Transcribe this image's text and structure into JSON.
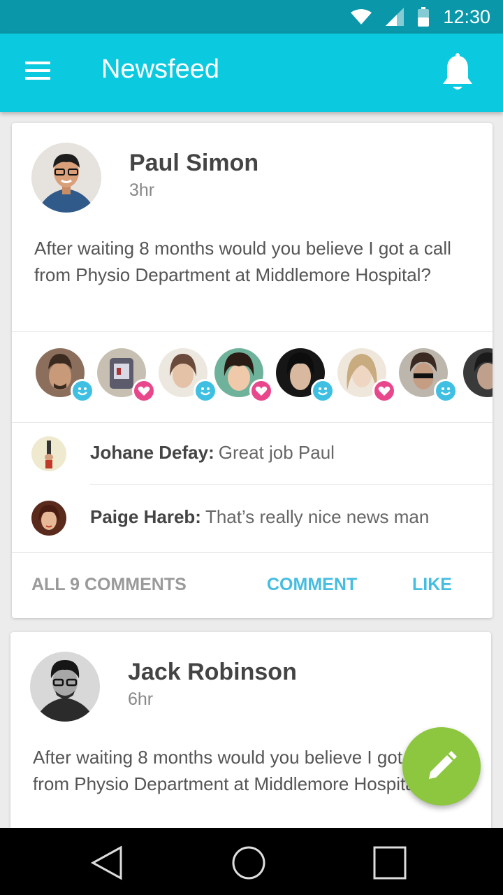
{
  "status_bar": {
    "time": "12:30"
  },
  "app_bar": {
    "title": "Newsfeed",
    "menu_icon": "menu-icon",
    "notification_icon": "bell-icon"
  },
  "colors": {
    "status_bar": "#0a97a9",
    "app_bar": "#0bcadf",
    "accent": "#45bde0",
    "fab": "#8dc63f",
    "heart": "#e8478c",
    "smile": "#3fc0e3"
  },
  "posts": [
    {
      "author": "Paul Simon",
      "time": "3hr",
      "text": "After waiting 8 months would you believe I got a call from Physio Department at Middlemore Hospital?",
      "reactions": [
        "smile",
        "heart",
        "smile",
        "heart",
        "smile",
        "heart",
        "smile",
        "none"
      ],
      "comments": [
        {
          "name": "Johane Defay:",
          "text": "Great job Paul"
        },
        {
          "name": "Paige Hareb:",
          "text": "That’s really nice news man"
        }
      ],
      "actions": {
        "all_comments": "ALL 9 COMMENTS",
        "comment": "COMMENT",
        "like": "LIKE"
      }
    },
    {
      "author": "Jack Robinson",
      "time": "6hr",
      "text": "After waiting 8 months would you believe I got a call from Physio Department at Middlemore Hospital?"
    }
  ],
  "fab": {
    "icon": "pencil-icon"
  },
  "nav_bar": {
    "back": "back-icon",
    "home": "home-icon",
    "recents": "recents-icon"
  }
}
